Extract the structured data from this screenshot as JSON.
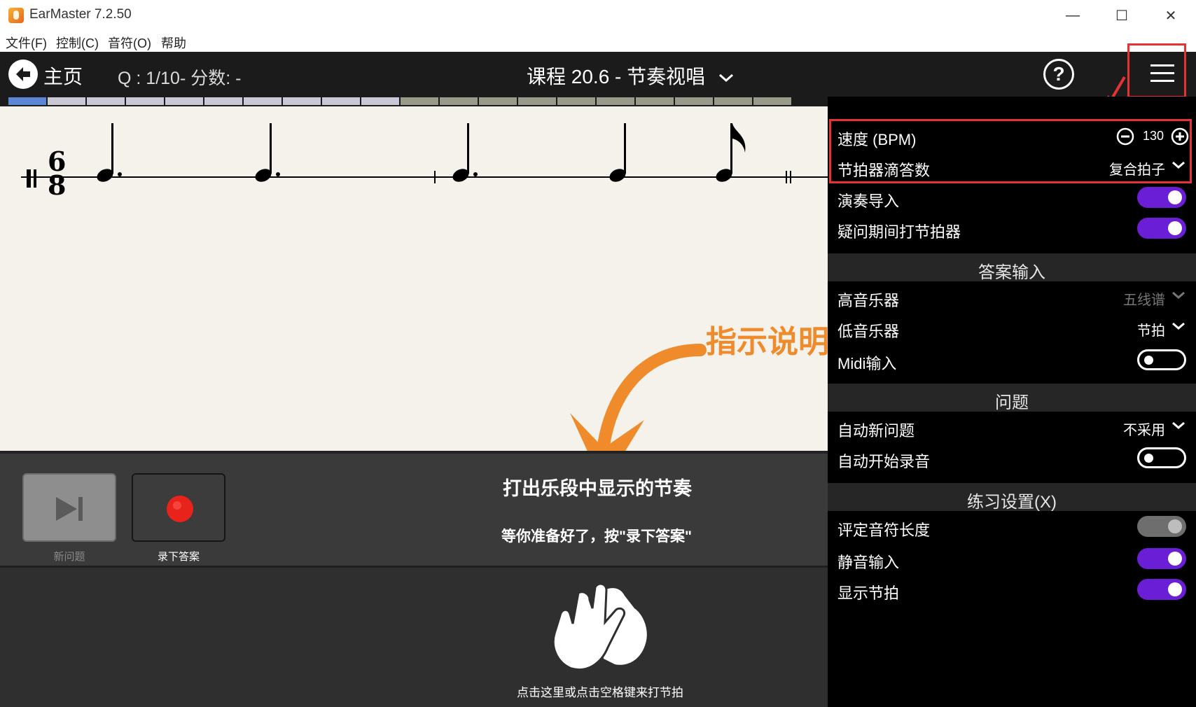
{
  "window": {
    "title": "EarMaster 7.2.50",
    "controls": [
      "—",
      "☐",
      "✕"
    ]
  },
  "menu": [
    "文件(F)",
    "控制(C)",
    "音符(O)",
    "帮助"
  ],
  "header": {
    "home_label": "主页",
    "question_status": "Q : 1/10- 分数: -",
    "course_title": "课程 20.6 - 节奏视唱",
    "help_symbol": "?"
  },
  "progress": {
    "current_index": 0,
    "total_segments": 20,
    "colors": {
      "current": "#5b86d6",
      "upcoming": "#c8c9d4",
      "later": "#9a9a8a"
    }
  },
  "score": {
    "time_signature": {
      "numerator": "6",
      "denominator": "8"
    },
    "hint_text": "指示说明"
  },
  "controls": {
    "new_question_label": "新问题",
    "record_label": "录下答案",
    "instruction_main": "打出乐段中显示的节奏",
    "instruction_sub": "等你准备好了，按\"录下答案\""
  },
  "tap_area": {
    "hint": "点击这里或点击空格键来打节拍"
  },
  "settings": {
    "tempo": {
      "label": "速度 (BPM)",
      "value": "130"
    },
    "metronome_clicks": {
      "label": "节拍器滴答数",
      "value": "复合拍子"
    },
    "count_in": {
      "label": "演奏导入",
      "state": "on"
    },
    "metronome_during_question": {
      "label": "疑问期间打节拍器",
      "state": "on"
    },
    "answer_input_section": "答案输入",
    "treble_instrument": {
      "label": "高音乐器",
      "value": "五线谱"
    },
    "bass_instrument": {
      "label": "低音乐器",
      "value": "节拍"
    },
    "midi_input": {
      "label": "Midi输入",
      "state": "off"
    },
    "question_section": "问题",
    "auto_new_question": {
      "label": "自动新问题",
      "value": "不采用"
    },
    "auto_start_recording": {
      "label": "自动开始录音",
      "state": "off"
    },
    "practice_section": "练习设置(X)",
    "grade_note_length": {
      "label": "评定音符长度",
      "state": "disabled"
    },
    "mute_input": {
      "label": "静音输入",
      "state": "on"
    },
    "show_beats": {
      "label": "显示节拍",
      "state": "on"
    }
  },
  "colors": {
    "annotation_red": "#e53333",
    "toggle_on": "#6a1fd6",
    "hint_orange": "#f08b2c",
    "record_red": "#e8231c"
  }
}
